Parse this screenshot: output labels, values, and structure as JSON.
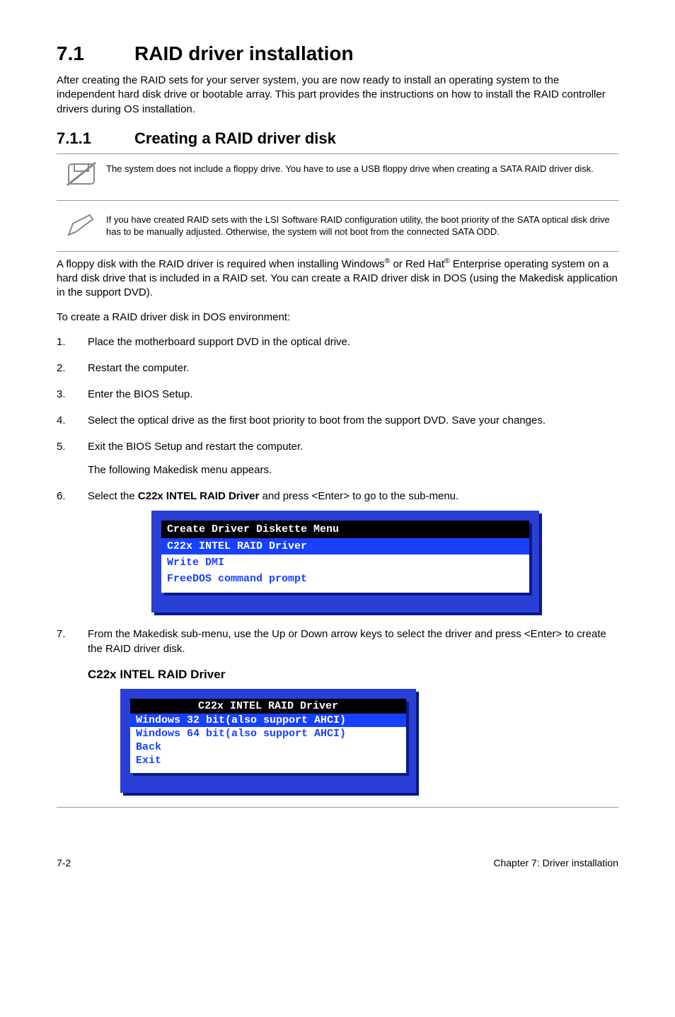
{
  "section": {
    "number": "7.1",
    "title": "RAID driver installation",
    "intro": "After creating the RAID sets for your server system, you are now ready to install an operating system to the independent hard disk drive or bootable array. This part provides the instructions on how to install the RAID controller drivers during OS installation."
  },
  "subsection": {
    "number": "7.1.1",
    "title": "Creating a RAID driver disk"
  },
  "notes": {
    "nofloppy": "The system does not include a floppy drive. You have to use a USB floppy drive when creating a SATA RAID driver disk.",
    "lsi": "If you have created RAID sets with the LSI Software RAID configuration utility, the boot priority of the SATA optical disk drive has to be manually adjusted. Otherwise, the system will not boot from the connected SATA ODD."
  },
  "para": {
    "floppy_pre": "A floppy disk with the RAID driver is required when installing Windows",
    "floppy_mid": " or Red Hat",
    "floppy_post": " Enterprise operating system on a hard disk drive that is included in a RAID set. You can create a RAID driver disk in DOS (using the Makedisk application in the support DVD).",
    "reg": "®",
    "dosenv": "To create a RAID driver disk in DOS environment:"
  },
  "steps": {
    "s1": "Place the motherboard support DVD in the optical drive.",
    "s2": "Restart the computer.",
    "s3": "Enter the BIOS Setup.",
    "s4": "Select the optical drive as the first boot priority to boot from the support DVD. Save your changes.",
    "s5": "Exit the BIOS Setup and restart the computer.",
    "s5b": "The following Makedisk menu appears.",
    "s6_pre": "Select the ",
    "s6_bold": "C22x INTEL RAID Driver",
    "s6_post": " and press <Enter> to go to the sub-menu.",
    "s7": "From the Makedisk sub-menu, use the Up or Down arrow keys to select the driver and press <Enter> to create the RAID driver disk."
  },
  "menu1": {
    "title": "Create Driver Diskette Menu",
    "selected": "C22x INTEL RAID Driver",
    "opt1": "Write DMI",
    "opt2": "FreeDOS command prompt"
  },
  "subhead2": "C22x INTEL RAID Driver",
  "menu2": {
    "title": "C22x INTEL RAID Driver",
    "selected": "Windows 32 bit(also support AHCI)",
    "opt1": "Windows 64 bit(also support AHCI)",
    "opt2": "Back",
    "opt3": "Exit"
  },
  "footer": {
    "left": "7-2",
    "right": "Chapter 7: Driver installation"
  }
}
